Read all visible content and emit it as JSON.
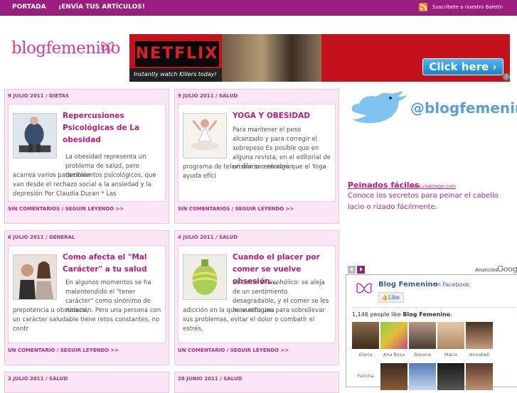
{
  "nav": {
    "home": "PORTADA",
    "submit": "¡ENVÍA TUS ARTÍCULOS!",
    "newsletter": "Suscríbete a nuestro Boletín"
  },
  "logo": {
    "text": "blogfemenino"
  },
  "banner": {
    "brand": "NETFLIX",
    "tagline": "Instantly watch Killers today!",
    "cta": "Click here ›"
  },
  "posts": [
    {
      "date": "9 JULIO 2011",
      "category": "DIETAS",
      "title": "Repercusiones Psicológicas de La obesidad",
      "intro": "La obesidad representa un problema de salud, pero también",
      "text": "acarrea varios padecimientos psicológicos, que van desde el rechazo social a la ansiedad y la depresión Por Claudia Duran * Las",
      "comments": "SIN COMENTARIOS",
      "more": "SEGUIR LEYENDO >>"
    },
    {
      "date": "9 JULIO 2011",
      "category": "SALUD",
      "title": "YOGA Y OBESIDAD",
      "intro": "Para mantener el peso alcanzado y para corregir el sobrepeso Es posible que en alguna revista, en el editorial de un diario o en algún",
      "text": "programa de televisión se enterara que el Yoga ayuda efici",
      "comments": "SIN COMENTARIOS",
      "more": "SEGUIR LEYENDO >>"
    },
    {
      "date": "6 JULIO 2011",
      "category": "GENERAL",
      "title": "Como afecta el \"Mal Carácter\" a tu salud",
      "intro": "En algunos momentos se ha malentendido el \"tener carácter\" como sinónimo de rudeza,",
      "text": "prepotencia u obstinación. Pero una persona con un carácter saludable tiene retos constantes, no contr",
      "comments": "UN COMENTARIO",
      "more": "SEGUIR LEYENDO >>"
    },
    {
      "date": "4 JULIO 2011",
      "category": "SALUD",
      "title": "Cuando el placer por comer se vuelve obsesión…",
      "intro": "Es como el alcohólico: se aleja de un sentimiento desagradable, y el comer se les ha vuelto una",
      "text": "adicción en la que se refugian para sobrellevar sus problemas, evitar el dolor o combatir el estrés.",
      "comments": "UN COMENTARIO",
      "more": "SEGUIR LEYENDO >>"
    },
    {
      "date": "2 JULIO 2011",
      "category": "SALUD"
    },
    {
      "date": "28 JUNIO 2011",
      "category": "SALUD"
    }
  ],
  "twitter": {
    "handle": "@blogfemenino"
  },
  "sponsored": {
    "title": "Peinados fáciles",
    "url": "www.vivemejor.com",
    "text": "Conoce los secretos para peinar el cabello lacio o rizado fácilmente."
  },
  "ads": {
    "label": "Anuncios",
    "brand": "Googl"
  },
  "facebook": {
    "page_name": "Blog Femenino",
    "on_facebook": "on Facebook",
    "like": "Like",
    "count_prefix": "1,146 people like ",
    "count_name": "Blog Femenino",
    "fans": [
      "Gloria",
      "Ana Rosa",
      "Roxana",
      "Maria",
      "Annabell",
      "Felicita"
    ]
  },
  "colors": {
    "topbar": "#9b1e7f",
    "accent": "#c0187f",
    "post_bg": "#fbe6f5",
    "twitter": "#5b9ed9",
    "facebook": "#3b5998"
  }
}
